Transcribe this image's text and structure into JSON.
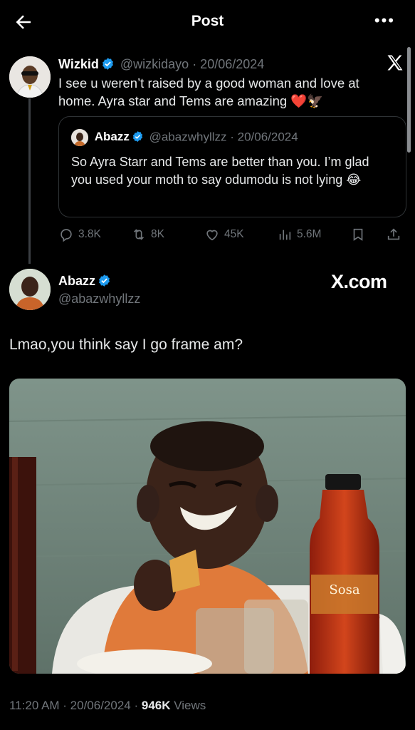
{
  "header": {
    "title": "Post"
  },
  "reply_parent": {
    "name": "Wizkid",
    "handle": "@wizkidayo",
    "date": "· 20/06/2024",
    "text": "I see u weren’t raised by a good woman and love at home. Ayra star and Tems are amazing ❤️🦅",
    "quote": {
      "name": "Abazz",
      "handle": "@abazwhyllzz",
      "date": "· 20/06/2024",
      "text": "So Ayra Starr and Tems are better than you. I’m glad you used your moth to say odumodu is not lying 😂"
    },
    "stats": {
      "replies": "3.8K",
      "reposts": "8K",
      "likes": "45K",
      "views": "5.6M"
    }
  },
  "main_post": {
    "name": "Abazz",
    "handle": "@abazwhyllzz",
    "text": "Lmao,you think say I go frame am?",
    "bottle_label": "Sosa",
    "watermark": "X.com"
  },
  "footer": {
    "time": "11:20 AM · 20/06/2024 ·",
    "views_count": "946K",
    "views_label": "Views"
  },
  "colors": {
    "background": "#000000",
    "muted": "#71767b",
    "verified": "#1d9bf0",
    "text": "#e7e9ea"
  }
}
